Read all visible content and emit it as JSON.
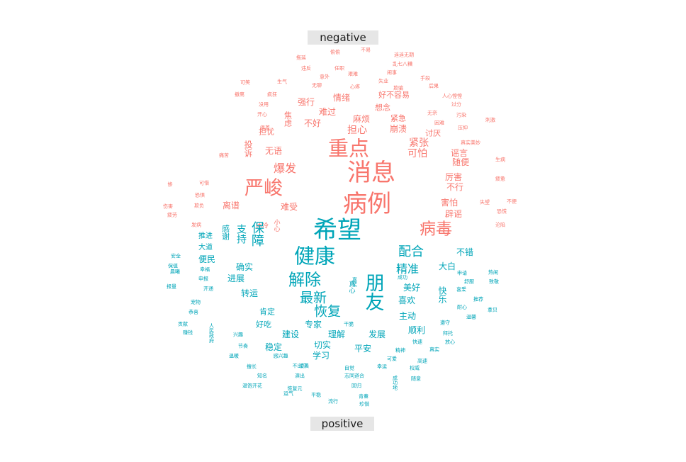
{
  "chart_data": {
    "type": "wordcloud",
    "title": "",
    "colors": {
      "negative": "#F8766D",
      "positive": "#00A5B8"
    },
    "groups": [
      {
        "name": "negative",
        "label": "negative",
        "words": [
          {
            "text": "消息",
            "weight": 20
          },
          {
            "text": "病例",
            "weight": 20
          },
          {
            "text": "重点",
            "weight": 17
          },
          {
            "text": "严峻",
            "weight": 14
          },
          {
            "text": "病毒",
            "weight": 12
          },
          {
            "text": "爆发",
            "weight": 8
          },
          {
            "text": "紧张",
            "weight": 7
          },
          {
            "text": "可怕",
            "weight": 7
          },
          {
            "text": "担心",
            "weight": 7
          },
          {
            "text": "无语",
            "weight": 6
          },
          {
            "text": "不行",
            "weight": 6
          },
          {
            "text": "害怕",
            "weight": 6
          },
          {
            "text": "厉害",
            "weight": 6
          },
          {
            "text": "辟谣",
            "weight": 6
          },
          {
            "text": "难受",
            "weight": 6
          },
          {
            "text": "离谱",
            "weight": 6
          },
          {
            "text": "投诉",
            "weight": 6
          },
          {
            "text": "谣言",
            "weight": 6
          },
          {
            "text": "随便",
            "weight": 6
          },
          {
            "text": "崩溃",
            "weight": 6
          },
          {
            "text": "不好",
            "weight": 6
          },
          {
            "text": "情绪",
            "weight": 6
          },
          {
            "text": "强行",
            "weight": 6
          },
          {
            "text": "难过",
            "weight": 6
          },
          {
            "text": "麻烦",
            "weight": 6
          },
          {
            "text": "紧急",
            "weight": 5
          },
          {
            "text": "讨厌",
            "weight": 5
          },
          {
            "text": "想念",
            "weight": 5
          },
          {
            "text": "好不容易",
            "weight": 5
          },
          {
            "text": "焦虑",
            "weight": 5
          },
          {
            "text": "担忧",
            "weight": 5
          },
          {
            "text": "小心",
            "weight": 3
          },
          {
            "text": "冰冷",
            "weight": 3
          },
          {
            "text": "不易",
            "weight": 2
          },
          {
            "text": "偷偷",
            "weight": 2
          },
          {
            "text": "遥遥无期",
            "weight": 2
          },
          {
            "text": "乱七八糟",
            "weight": 2
          },
          {
            "text": "拖延",
            "weight": 2
          },
          {
            "text": "违反",
            "weight": 2
          },
          {
            "text": "任职",
            "weight": 2
          },
          {
            "text": "艰难",
            "weight": 2
          },
          {
            "text": "闹事",
            "weight": 2
          },
          {
            "text": "手段",
            "weight": 2
          },
          {
            "text": "后果",
            "weight": 2
          },
          {
            "text": "无聊",
            "weight": 2
          },
          {
            "text": "意外",
            "weight": 2
          },
          {
            "text": "心疼",
            "weight": 2
          },
          {
            "text": "失业",
            "weight": 2
          },
          {
            "text": "欺骗",
            "weight": 2
          },
          {
            "text": "可笑",
            "weight": 2
          },
          {
            "text": "生气",
            "weight": 2
          },
          {
            "text": "疯狂",
            "weight": 2
          },
          {
            "text": "没用",
            "weight": 2
          },
          {
            "text": "开心",
            "weight": 2
          },
          {
            "text": "很差",
            "weight": 2
          },
          {
            "text": "无奈",
            "weight": 2
          },
          {
            "text": "困难",
            "weight": 2
          },
          {
            "text": "人心惶惶",
            "weight": 2
          },
          {
            "text": "过分",
            "weight": 2
          },
          {
            "text": "压抑",
            "weight": 2
          },
          {
            "text": "刺激",
            "weight": 2
          },
          {
            "text": "真实美妙",
            "weight": 2
          },
          {
            "text": "生病",
            "weight": 2
          },
          {
            "text": "不便",
            "weight": 2
          },
          {
            "text": "失望",
            "weight": 2
          },
          {
            "text": "恐慌",
            "weight": 2
          },
          {
            "text": "沦陷",
            "weight": 2
          },
          {
            "text": "污染",
            "weight": 2
          },
          {
            "text": "疲惫",
            "weight": 2
          },
          {
            "text": "痛苦",
            "weight": 2
          },
          {
            "text": "可惜",
            "weight": 2
          },
          {
            "text": "恐惧",
            "weight": 2
          },
          {
            "text": "伤害",
            "weight": 2
          },
          {
            "text": "欺负",
            "weight": 2
          },
          {
            "text": "惨",
            "weight": 2
          },
          {
            "text": "撤离",
            "weight": 2
          },
          {
            "text": "发病",
            "weight": 2
          },
          {
            "text": "疲劳",
            "weight": 2
          }
        ]
      },
      {
        "name": "positive",
        "label": "positive",
        "words": [
          {
            "text": "希望",
            "weight": 20
          },
          {
            "text": "健康",
            "weight": 16
          },
          {
            "text": "朋友",
            "weight": 14
          },
          {
            "text": "解除",
            "weight": 12
          },
          {
            "text": "恢复",
            "weight": 10
          },
          {
            "text": "最新",
            "weight": 10
          },
          {
            "text": "保障",
            "weight": 9
          },
          {
            "text": "配合",
            "weight": 9
          },
          {
            "text": "精准",
            "weight": 8
          },
          {
            "text": "支持",
            "weight": 7
          },
          {
            "text": "确实",
            "weight": 6
          },
          {
            "text": "进展",
            "weight": 6
          },
          {
            "text": "转运",
            "weight": 6
          },
          {
            "text": "美好",
            "weight": 6
          },
          {
            "text": "喜欢",
            "weight": 6
          },
          {
            "text": "专家",
            "weight": 6
          },
          {
            "text": "理解",
            "weight": 6
          },
          {
            "text": "发展",
            "weight": 6
          },
          {
            "text": "顺利",
            "weight": 6
          },
          {
            "text": "主动",
            "weight": 6
          },
          {
            "text": "大白",
            "weight": 6
          },
          {
            "text": "不错",
            "weight": 6
          },
          {
            "text": "便民",
            "weight": 6
          },
          {
            "text": "快乐",
            "weight": 6
          },
          {
            "text": "建设",
            "weight": 6
          },
          {
            "text": "稳定",
            "weight": 6
          },
          {
            "text": "切实",
            "weight": 6
          },
          {
            "text": "学习",
            "weight": 6
          },
          {
            "text": "平安",
            "weight": 6
          },
          {
            "text": "肯定",
            "weight": 5
          },
          {
            "text": "好吃",
            "weight": 5
          },
          {
            "text": "感谢",
            "weight": 5
          },
          {
            "text": "大道",
            "weight": 4
          },
          {
            "text": "推进",
            "weight": 4
          },
          {
            "text": "真心",
            "weight": 3
          },
          {
            "text": "成功",
            "weight": 2
          },
          {
            "text": "幸福",
            "weight": 2
          },
          {
            "text": "申报",
            "weight": 2
          },
          {
            "text": "开通",
            "weight": 2
          },
          {
            "text": "安全",
            "weight": 2
          },
          {
            "text": "保值",
            "weight": 2
          },
          {
            "text": "晨曦",
            "weight": 2
          },
          {
            "text": "报量",
            "weight": 2
          },
          {
            "text": "宠物",
            "weight": 2
          },
          {
            "text": "恭喜",
            "weight": 2
          },
          {
            "text": "贡献",
            "weight": 2
          },
          {
            "text": "赚钱",
            "weight": 2
          },
          {
            "text": "人民政府",
            "weight": 2
          },
          {
            "text": "兴趣",
            "weight": 2
          },
          {
            "text": "节奏",
            "weight": 2
          },
          {
            "text": "温暖",
            "weight": 2
          },
          {
            "text": "感兴趣",
            "weight": 2
          },
          {
            "text": "擅长",
            "weight": 2
          },
          {
            "text": "知名",
            "weight": 2
          },
          {
            "text": "温饱开花",
            "weight": 2
          },
          {
            "text": "运气",
            "weight": 2
          },
          {
            "text": "平稳",
            "weight": 2
          },
          {
            "text": "流行",
            "weight": 2
          },
          {
            "text": "青春",
            "weight": 2
          },
          {
            "text": "珍惜",
            "weight": 2
          },
          {
            "text": "自觉",
            "weight": 2
          },
          {
            "text": "志同道合",
            "weight": 2
          },
          {
            "text": "幸运",
            "weight": 2
          },
          {
            "text": "权威",
            "weight": 2
          },
          {
            "text": "随意",
            "weight": 2
          },
          {
            "text": "高速",
            "weight": 2
          },
          {
            "text": "可爱",
            "weight": 2
          },
          {
            "text": "精神",
            "weight": 2
          },
          {
            "text": "快速",
            "weight": 2
          },
          {
            "text": "真实",
            "weight": 2
          },
          {
            "text": "放心",
            "weight": 2
          },
          {
            "text": "拜托",
            "weight": 2
          },
          {
            "text": "耐心",
            "weight": 2
          },
          {
            "text": "遵守",
            "weight": 2
          },
          {
            "text": "推荐",
            "weight": 2
          },
          {
            "text": "喜爱",
            "weight": 2
          },
          {
            "text": "热闹",
            "weight": 2
          },
          {
            "text": "致敬",
            "weight": 2
          },
          {
            "text": "申请",
            "weight": 2
          },
          {
            "text": "舒服",
            "weight": 2
          },
          {
            "text": "温馨",
            "weight": 2
          },
          {
            "text": "拿贝",
            "weight": 2
          },
          {
            "text": "嘉奖",
            "weight": 2
          },
          {
            "text": "干脆",
            "weight": 2
          },
          {
            "text": "凌晨",
            "weight": 2
          },
          {
            "text": "恢复元",
            "weight": 2
          },
          {
            "text": "不出户",
            "weight": 2
          },
          {
            "text": "演出",
            "weight": 2
          },
          {
            "text": "回归",
            "weight": 2
          },
          {
            "text": "成功地",
            "weight": 2
          }
        ]
      }
    ]
  }
}
